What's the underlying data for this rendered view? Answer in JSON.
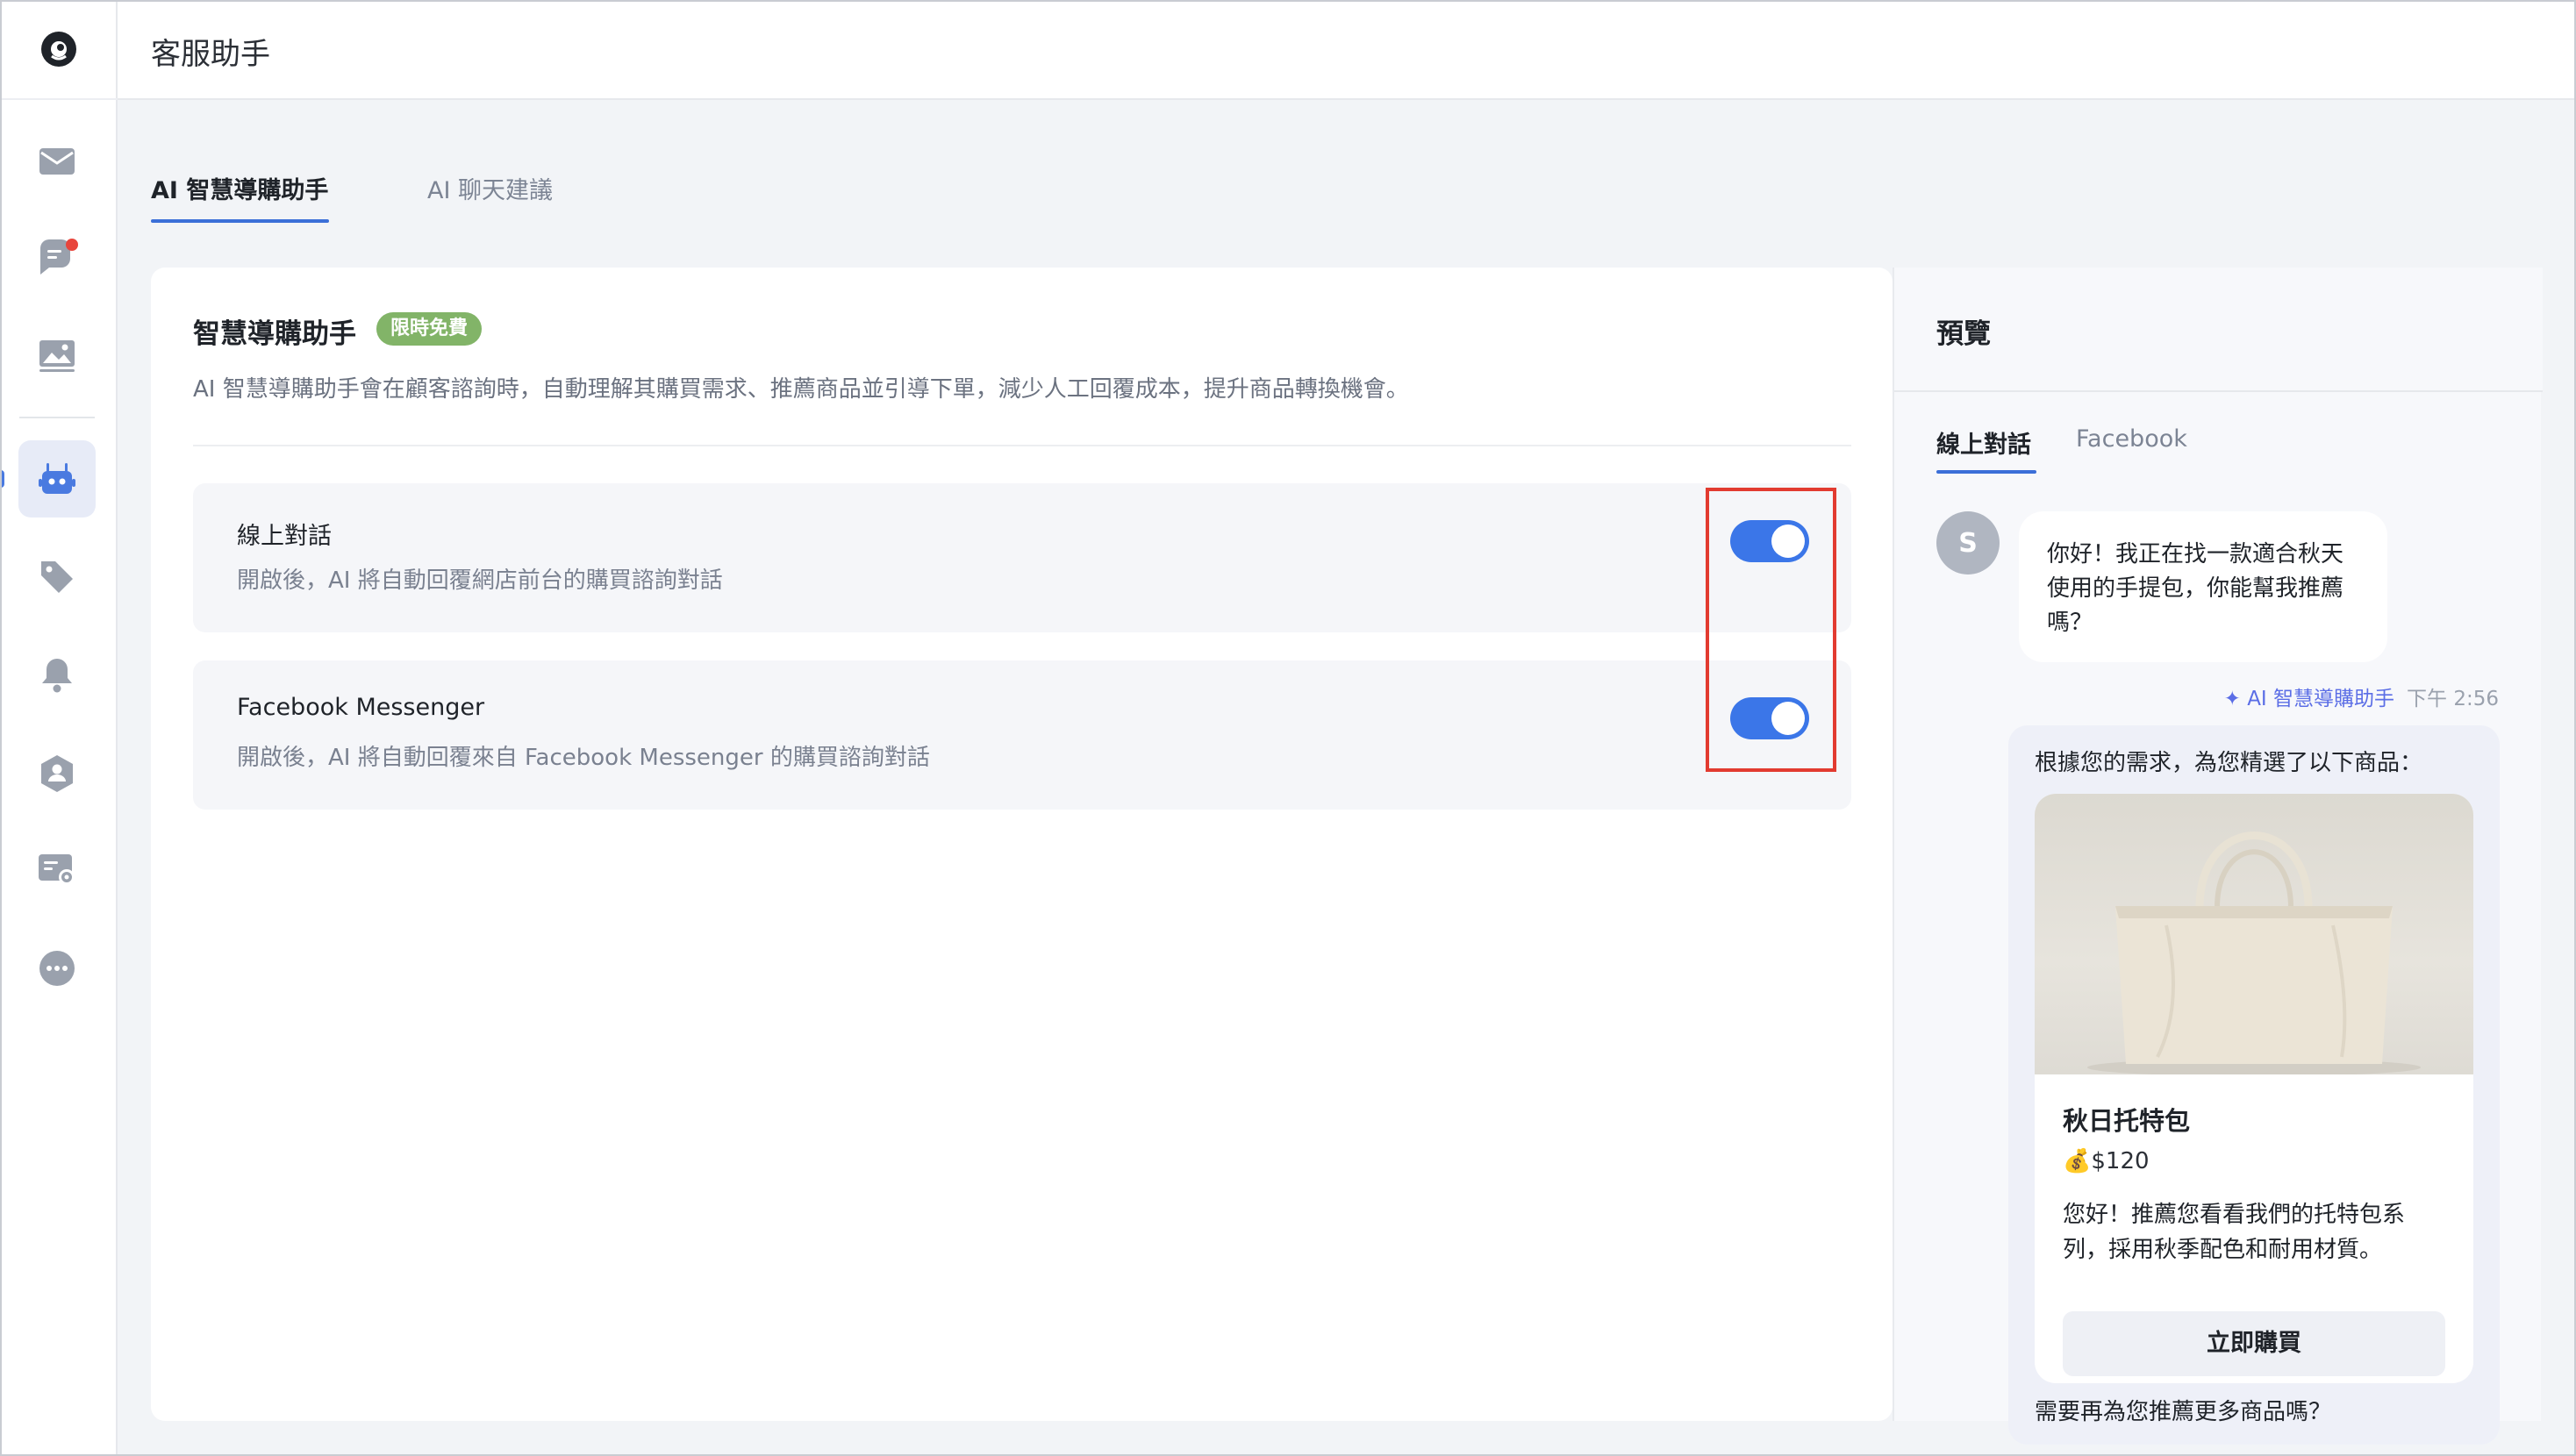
{
  "app": {
    "title": "客服助手"
  },
  "sidebar": {
    "items": [
      {
        "icon": "mail-icon"
      },
      {
        "icon": "chat-icon",
        "has_notification": true
      },
      {
        "icon": "image-icon"
      },
      {
        "icon": "robot-icon",
        "active": true
      },
      {
        "icon": "tag-icon"
      },
      {
        "icon": "bell-icon"
      },
      {
        "icon": "user-group-icon"
      },
      {
        "icon": "settings-card-icon"
      },
      {
        "icon": "more-icon"
      }
    ]
  },
  "tabs": [
    {
      "label": "AI 智慧導購助手",
      "active": true
    },
    {
      "label": "AI 聊天建議",
      "active": false
    }
  ],
  "settings": {
    "title": "智慧導購助手",
    "badge": "限時免費",
    "description": "AI 智慧導購助手會在顧客諮詢時，自動理解其購買需求、推薦商品並引導下單，減少人工回覆成本，提升商品轉換機會。",
    "channels": [
      {
        "title": "線上對話",
        "description": "開啟後，AI 將自動回覆網店前台的購買諮詢對話",
        "enabled": true
      },
      {
        "title": "Facebook Messenger",
        "description": "開啟後，AI 將自動回覆來自 Facebook Messenger 的購買諮詢對話",
        "enabled": true
      }
    ]
  },
  "preview": {
    "title": "預覽",
    "tabs": [
      {
        "label": "線上對話",
        "active": true
      },
      {
        "label": "Facebook",
        "active": false
      }
    ],
    "user_avatar": "S",
    "user_message": "你好！我正在找一款適合秋天使用的手提包，你能幫我推薦嗎？",
    "ai_label": "✦ AI 智慧導購助手",
    "ai_time": "下午 2:56",
    "ai_intro": "根據您的需求，為您精選了以下商品：",
    "product": {
      "name": "秋日托特包",
      "price": "💰$120",
      "description": "您好！推薦您看看我們的托特包系列，採用秋季配色和耐用材質。",
      "buy_label": "立即購買"
    },
    "followup": "需要再為您推薦更多商品嗎？"
  },
  "colors": {
    "accent": "#3b76e8",
    "badge": "#82b468",
    "notification": "#e8453c",
    "highlight": "#e23b30"
  }
}
